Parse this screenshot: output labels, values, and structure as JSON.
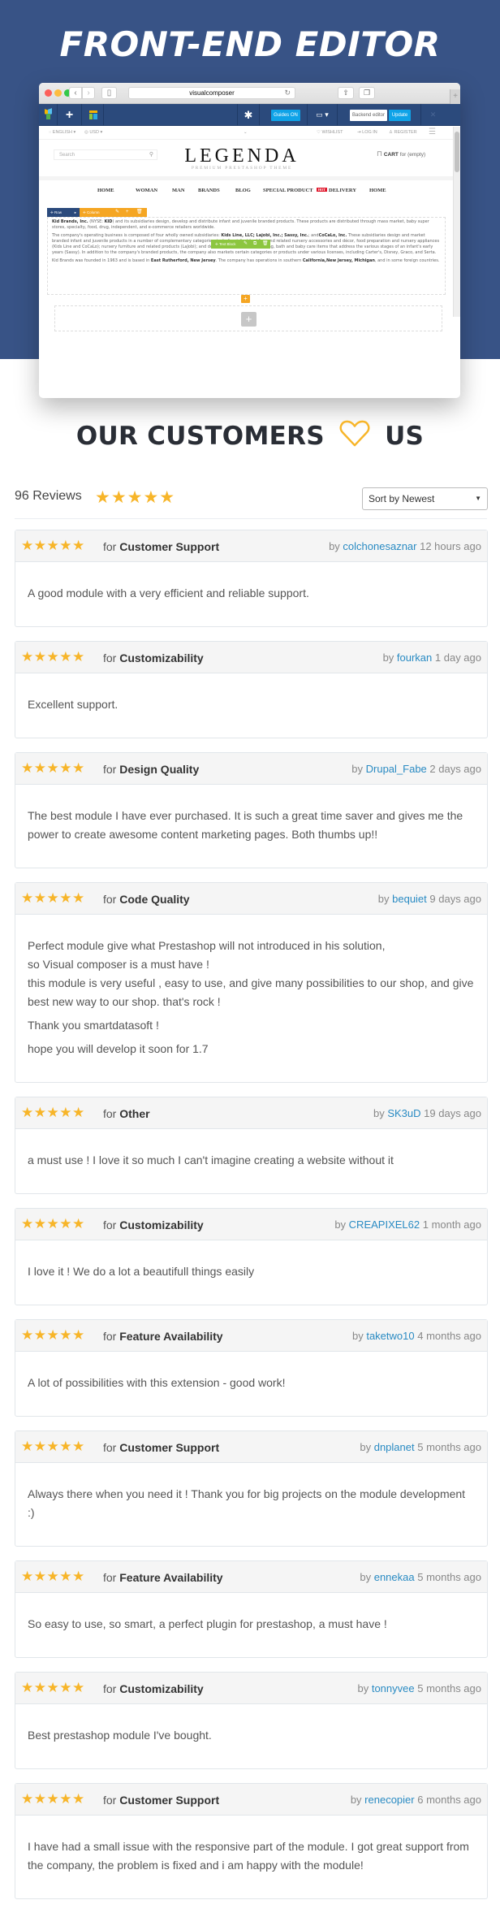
{
  "hero": {
    "title": "FRONT-END EDITOR",
    "background": "#385386"
  },
  "browser": {
    "url": "visualcomposer",
    "back_glyph": "‹",
    "forward_glyph": "›",
    "reload_glyph": "↻",
    "share_glyph": "⇧",
    "tabs_glyph": "❐",
    "newtab_glyph": "+"
  },
  "editor_toolbar": {
    "add_glyph": "+",
    "settings_glyph": "✱",
    "guides_label": "Guides ON",
    "device_glyph": "▭ ▾",
    "backend_label": "Backend editor",
    "update_label": "Update",
    "close_glyph": "✕"
  },
  "site": {
    "topbar": {
      "language": "ENGLISH ▾",
      "currency": "USD ▾",
      "toggle": "⌄",
      "wishlist": "WISHLIST",
      "login": "LOG IN",
      "register": "REGISTER",
      "menu_glyph": "☰"
    },
    "search_placeholder": "Search",
    "logo": "LEGENDA",
    "logo_sub": "PREMIUM PRESTASHOP THEME",
    "cart_label": "CART",
    "cart_status": "for (empty)",
    "menu": [
      "HOME",
      "WOMAN",
      "MAN",
      "BRANDS",
      "BLOG",
      "SPECIAL PRODUCT",
      "DELIVERY",
      "HOME"
    ],
    "hot_badge": "HOT",
    "row_label": "Row",
    "column_label": "Column",
    "textblock_label": "Text Block",
    "paragraphs": {
      "p1_bold": "Kid Brands, Inc.",
      "p1_a": " (NYSE: ",
      "p1_bold2": "KID",
      "p1_b": ") and its subsidiaries design, develop and distribute infant and juvenile branded products. These products are distributed through mass market, baby super stores, specialty, food, drug, independent, and e-commerce retailers worldwide.",
      "p2_a": "The company's operating business is composed of four wholly owned subsidiaries: ",
      "p2_bold": "Kids Line, LLC; Lajobi, Inc.; Sassy, Inc.",
      "p2_b": "; and",
      "p2_bold2": "CoCaLo, Inc.",
      "p2_c": " These subsidiaries design and market branded infant and juvenile products in a number of complementary categories, including infant bedding and related nursery accessories and décor, food preparation and nursery appliances (Kids Line and CoCaLo); nursery furniture and related products (LaJobi); and developmental toys and feeding, bath and baby care items that address the various stages of an infant's early years (Sassy). In addition to the company's branded products, the company also markets certain categories or products under various licenses, including Carter's, Disney, Graco, and Serta.",
      "p3_a": "Kid Brands was founded in 1963 and is based in ",
      "p3_bold": "East Rutherford, New Jersey",
      "p3_b": ". The company has operations in southern ",
      "p3_bold2": "California,New Jersey, Michigan",
      "p3_c": ", and in some foreign countries."
    }
  },
  "customers": {
    "heading_left": "OUR CUSTOMERS",
    "heading_right": "US",
    "heart_color": "#f7b529",
    "reviews_count": "96 Reviews",
    "summary_rating": 5,
    "star_glyphs": "★★★★★",
    "sort_value": "Sort by Newest",
    "sort_arrow": "▼"
  },
  "reviews": [
    {
      "rating": 5,
      "stars": "★★★★★",
      "for_prefix": "for ",
      "category": "Customer Support",
      "by_prefix": "by ",
      "author": "colchonesaznar",
      "time": " 12 hours ago",
      "paragraphs": [
        "A good module with a very efficient and reliable support."
      ]
    },
    {
      "rating": 5,
      "stars": "★★★★★",
      "for_prefix": "for ",
      "category": "Customizability",
      "by_prefix": "by ",
      "author": "fourkan",
      "time": " 1 day ago",
      "paragraphs": [
        "Excellent support."
      ]
    },
    {
      "rating": 5,
      "stars": "★★★★★",
      "for_prefix": "for ",
      "category": "Design Quality",
      "by_prefix": "by ",
      "author": "Drupal_Fabe",
      "time": " 2 days ago",
      "paragraphs": [
        "The best module I have ever purchased. It is such a great time saver and gives me the power to create awesome content marketing pages. Both thumbs up!!"
      ]
    },
    {
      "rating": 5,
      "stars": "★★★★★",
      "for_prefix": "for ",
      "category": "Code Quality",
      "by_prefix": "by ",
      "author": "bequiet",
      "time": " 9 days ago",
      "paragraphs": [
        "Perfect module give what Prestashop will not introduced in his solution,\nso Visual composer is a must have !\nthis module is very useful , easy to use, and give many possibilities to our shop, and give best new way to our shop. that's rock !",
        "Thank you smartdatasoft !",
        "hope you will develop it soon for 1.7"
      ]
    },
    {
      "rating": 5,
      "stars": "★★★★★",
      "for_prefix": "for ",
      "category": "Other",
      "by_prefix": "by ",
      "author": "SK3uD",
      "time": " 19 days ago",
      "paragraphs": [
        "a must use ! I love it so much I can't imagine creating a website without it"
      ]
    },
    {
      "rating": 5,
      "stars": "★★★★★",
      "for_prefix": "for ",
      "category": "Customizability",
      "by_prefix": "by ",
      "author": "CREAPIXEL62",
      "time": " 1 month ago",
      "paragraphs": [
        "I love it ! We do a lot a beautifull things easily"
      ]
    },
    {
      "rating": 5,
      "stars": "★★★★★",
      "for_prefix": "for ",
      "category": "Feature Availability",
      "by_prefix": "by ",
      "author": "taketwo10",
      "time": " 4 months ago",
      "paragraphs": [
        "A lot of possibilities with this extension - good work!"
      ]
    },
    {
      "rating": 5,
      "stars": "★★★★★",
      "for_prefix": "for ",
      "category": "Customer Support",
      "by_prefix": "by ",
      "author": "dnplanet",
      "time": " 5 months ago",
      "paragraphs": [
        "Always there when you need it ! Thank you for big projects on the module development :)"
      ]
    },
    {
      "rating": 5,
      "stars": "★★★★★",
      "for_prefix": "for ",
      "category": "Feature Availability",
      "by_prefix": "by ",
      "author": "ennekaa",
      "time": " 5 months ago",
      "paragraphs": [
        "So easy to use, so smart, a perfect plugin for prestashop, a must have !"
      ]
    },
    {
      "rating": 5,
      "stars": "★★★★★",
      "for_prefix": "for ",
      "category": "Customizability",
      "by_prefix": "by ",
      "author": "tonnyvee",
      "time": " 5 months ago",
      "paragraphs": [
        "Best prestashop module I've bought."
      ]
    },
    {
      "rating": 5,
      "stars": "★★★★★",
      "for_prefix": "for ",
      "category": "Customer Support",
      "by_prefix": "by ",
      "author": "renecopier",
      "time": " 6 months ago",
      "paragraphs": [
        "I have had a small issue with the responsive part of the module. I got great support from the company, the problem is fixed and i am happy with the module!"
      ]
    }
  ]
}
